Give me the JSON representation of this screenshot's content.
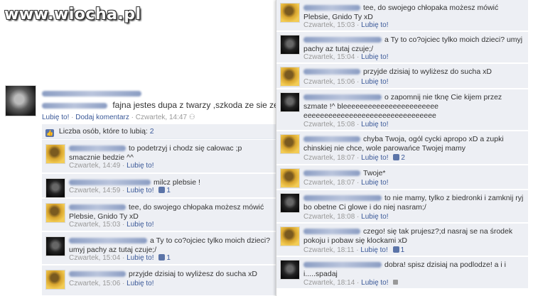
{
  "watermark": "www.wiocha.pl",
  "post": {
    "author": "",
    "tagged": "",
    "text": "fajna jestes dupa z twarzy ,szkoda ze sie zesrales :D",
    "like_link": "Lubię to!",
    "comment_link": "Dodaj komentarz",
    "time": "Czwartek, 14:47",
    "likes_label": "Liczba osób, które to lubią:",
    "likes_count": "2"
  },
  "left_comments": [
    {
      "avatar": "yellow",
      "text": "to podetrzyj i chodz się całowac ;p smacznie bedzie ^^",
      "time": "Czwartek, 14:49",
      "like": "Lubię to!",
      "likes": ""
    },
    {
      "avatar": "dark",
      "text": "milcz plebsie !",
      "time": "Czwartek, 14:59",
      "like": "Lubię to!",
      "likes": "1"
    },
    {
      "avatar": "yellow",
      "text": "tee, do swojego chłopaka możesz mówić Plebsie, Gnido Ty xD",
      "time": "Czwartek, 15:03",
      "like": "Lubię to!",
      "likes": ""
    },
    {
      "avatar": "dark",
      "text": "a Ty to co?ojciec tylko moich dzieci? umyj pachy az tutaj czuje;/",
      "time": "Czwartek, 15:04",
      "like": "Lubię to!",
      "likes": "1"
    },
    {
      "avatar": "yellow",
      "text": "przyjde dzisiaj to wyliżesz do sucha xD",
      "time": "Czwartek, 15:06",
      "like": "Lubię to!",
      "likes": ""
    }
  ],
  "right_comments": [
    {
      "avatar": "yellow",
      "text": "tee, do swojego chłopaka możesz mówić Plebsie, Gnido Ty xD",
      "time": "Czwartek, 15:03",
      "like": "Lubię to!",
      "likes": ""
    },
    {
      "avatar": "dark",
      "text": "a Ty to co?ojciec tylko moich dzieci? umyj pachy az tutaj czuje;/",
      "time": "Czwartek, 15:04",
      "like": "Lubię to!",
      "likes": ""
    },
    {
      "avatar": "yellow",
      "text": "przyjde dzisiaj to wyliżesz do sucha xD",
      "time": "Czwartek, 15:06",
      "like": "Lubię to!",
      "likes": ""
    },
    {
      "avatar": "dark",
      "text": "o zapomnij nie tknę Cie kijem przez szmate !^ bleeeeeeeeeeeeeeeeeeeeeee eeeeeeeeeeeeeeeeeeeeeeeeeeeeeeee",
      "time": "Czwartek, 15:08",
      "like": "Lubię to!",
      "likes": ""
    },
    {
      "avatar": "yellow",
      "text": "chyba Twoja, ogól cycki apropo xD a zupki chinskiej nie chce, wole parowańce Twojej mamy",
      "time": "Czwartek, 18:07",
      "like": "Lubię to!",
      "likes": "2"
    },
    {
      "avatar": "yellow",
      "text": "Twoje*",
      "time": "Czwartek, 18:07",
      "like": "Lubię to!",
      "likes": ""
    },
    {
      "avatar": "dark",
      "text": "to nie mamy, tylko z biedronki i zamknij ryj bo obetne Ci glowe i do niej nasram;/",
      "time": "Czwartek, 18:08",
      "like": "Lubię to!",
      "likes": ""
    },
    {
      "avatar": "yellow",
      "text": "czego! się tak prujesz?;d nasraj se na środek pokoju i pobaw się klockami xD",
      "time": "Czwartek, 18:11",
      "like": "Lubię to!",
      "likes": "1"
    },
    {
      "avatar": "dark",
      "text": "dobra! spisz dzisiaj na podlodze! a i i i.....spadaj",
      "time": "Czwartek, 18:14",
      "like": "Lubię to!",
      "likes": ""
    }
  ]
}
